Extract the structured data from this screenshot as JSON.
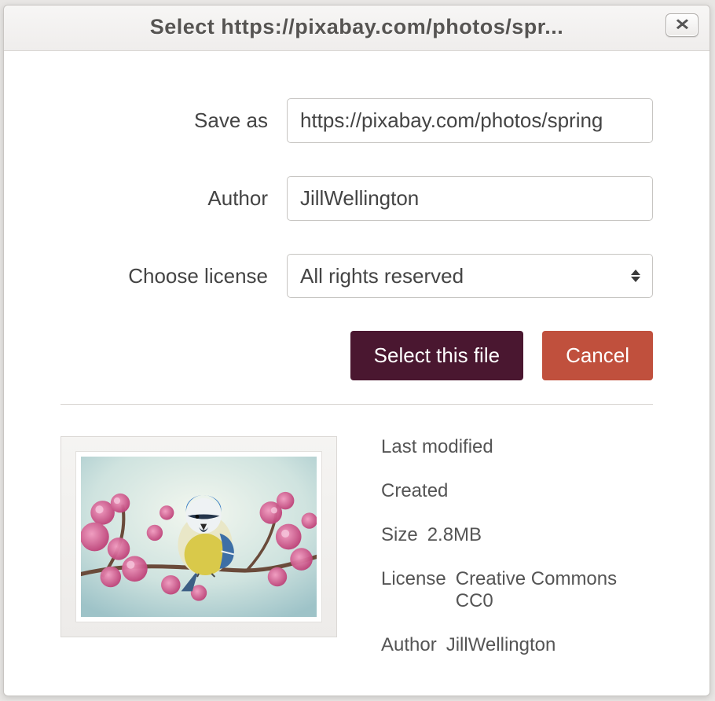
{
  "dialog": {
    "title": "Select https://pixabay.com/photos/spr...",
    "close_glyph": "✕"
  },
  "form": {
    "save_as": {
      "label": "Save as",
      "value": "https://pixabay.com/photos/spring"
    },
    "author": {
      "label": "Author",
      "value": "JillWellington"
    },
    "license": {
      "label": "Choose license",
      "selected": "All rights reserved"
    }
  },
  "buttons": {
    "select": "Select this file",
    "cancel": "Cancel"
  },
  "meta": {
    "last_modified": {
      "label": "Last modified",
      "value": ""
    },
    "created": {
      "label": "Created",
      "value": ""
    },
    "size": {
      "label": "Size",
      "value": "2.8MB"
    },
    "license": {
      "label": "License",
      "value": "Creative Commons CC0"
    },
    "author": {
      "label": "Author",
      "value": "JillWellington"
    }
  }
}
